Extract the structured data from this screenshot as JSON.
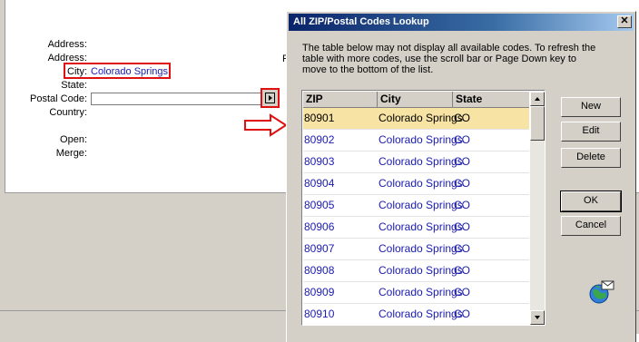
{
  "form": {
    "labels": {
      "address1": "Address:",
      "address2": "Address:",
      "city": "City:",
      "state": "State:",
      "postal_code": "Postal Code:",
      "country": "Country:",
      "open": "Open:",
      "merge": "Merge:"
    },
    "city_value": "Colorado Springs",
    "postal_code_value": "",
    "partial_label": "F"
  },
  "dialog": {
    "title": "All ZIP/Postal Codes Lookup",
    "close_label": "✕",
    "description": "The table below may not display all available codes.  To refresh the table with more codes, use the scroll bar or Page Down key to move to the bottom of the list.",
    "columns": [
      "ZIP",
      "City",
      "State"
    ],
    "rows": [
      {
        "zip": "80901",
        "city": "Colorado Springs",
        "state": "CO",
        "selected": true
      },
      {
        "zip": "80902",
        "city": "Colorado Springs",
        "state": "CO"
      },
      {
        "zip": "80903",
        "city": "Colorado Springs",
        "state": "CO"
      },
      {
        "zip": "80904",
        "city": "Colorado Springs",
        "state": "CO"
      },
      {
        "zip": "80905",
        "city": "Colorado Springs",
        "state": "CO"
      },
      {
        "zip": "80906",
        "city": "Colorado Springs",
        "state": "CO"
      },
      {
        "zip": "80907",
        "city": "Colorado Springs",
        "state": "CO"
      },
      {
        "zip": "80908",
        "city": "Colorado Springs",
        "state": "CO"
      },
      {
        "zip": "80909",
        "city": "Colorado Springs",
        "state": "CO"
      },
      {
        "zip": "80910",
        "city": "Colorado Springs",
        "state": "CO"
      }
    ],
    "buttons": {
      "new": "New",
      "edit": "Edit",
      "delete": "Delete",
      "ok": "OK",
      "cancel": "Cancel"
    }
  },
  "colors": {
    "highlight": "#e01010",
    "selected_row": "#f7e3a3",
    "link_text": "#1a1ab0",
    "titlebar_start": "#0a246a"
  },
  "icons": {
    "lookup": "triangle-right-icon",
    "globe": "globe-mail-icon",
    "arrow": "red-arrow-icon"
  }
}
